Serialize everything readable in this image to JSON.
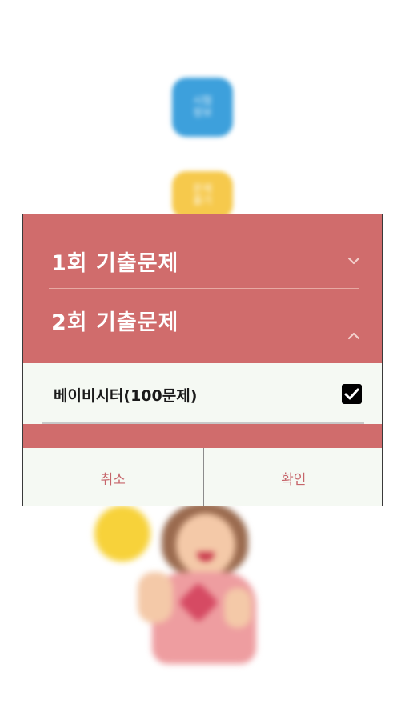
{
  "background": {
    "tiles": [
      {
        "name": "exam-info-tile",
        "label": "시험\n정보",
        "color": "#3da0dc"
      },
      {
        "name": "problem-tile",
        "label": "문제\n풀기",
        "color": "#f6c94c"
      }
    ]
  },
  "dialog": {
    "groups": [
      {
        "title": "1회 기출문제",
        "expanded": false
      },
      {
        "title": "2회 기출문제",
        "expanded": true
      }
    ],
    "items": [
      {
        "label": "베이비시터(100문제)",
        "checked": true
      }
    ],
    "buttons": {
      "cancel_label": "취소",
      "confirm_label": "확인"
    },
    "colors": {
      "header_bg": "#d06c6c",
      "row_bg": "#f5f9f3",
      "button_text": "#c6656a"
    }
  }
}
